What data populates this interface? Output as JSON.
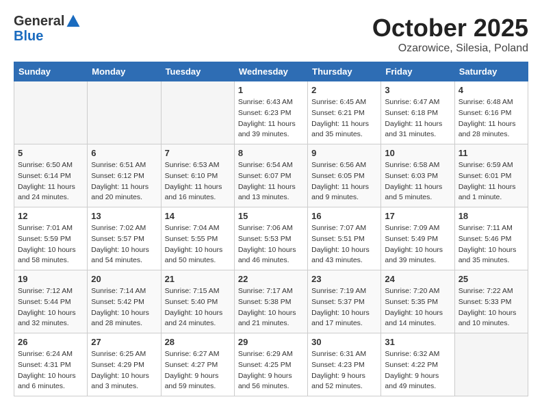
{
  "header": {
    "logo_general": "General",
    "logo_blue": "Blue",
    "month_title": "October 2025",
    "location": "Ozarowice, Silesia, Poland"
  },
  "days_of_week": [
    "Sunday",
    "Monday",
    "Tuesday",
    "Wednesday",
    "Thursday",
    "Friday",
    "Saturday"
  ],
  "weeks": [
    [
      {
        "day": "",
        "empty": true
      },
      {
        "day": "",
        "empty": true
      },
      {
        "day": "",
        "empty": true
      },
      {
        "day": "1",
        "sunrise": "Sunrise: 6:43 AM",
        "sunset": "Sunset: 6:23 PM",
        "daylight": "Daylight: 11 hours and 39 minutes."
      },
      {
        "day": "2",
        "sunrise": "Sunrise: 6:45 AM",
        "sunset": "Sunset: 6:21 PM",
        "daylight": "Daylight: 11 hours and 35 minutes."
      },
      {
        "day": "3",
        "sunrise": "Sunrise: 6:47 AM",
        "sunset": "Sunset: 6:18 PM",
        "daylight": "Daylight: 11 hours and 31 minutes."
      },
      {
        "day": "4",
        "sunrise": "Sunrise: 6:48 AM",
        "sunset": "Sunset: 6:16 PM",
        "daylight": "Daylight: 11 hours and 28 minutes."
      }
    ],
    [
      {
        "day": "5",
        "sunrise": "Sunrise: 6:50 AM",
        "sunset": "Sunset: 6:14 PM",
        "daylight": "Daylight: 11 hours and 24 minutes."
      },
      {
        "day": "6",
        "sunrise": "Sunrise: 6:51 AM",
        "sunset": "Sunset: 6:12 PM",
        "daylight": "Daylight: 11 hours and 20 minutes."
      },
      {
        "day": "7",
        "sunrise": "Sunrise: 6:53 AM",
        "sunset": "Sunset: 6:10 PM",
        "daylight": "Daylight: 11 hours and 16 minutes."
      },
      {
        "day": "8",
        "sunrise": "Sunrise: 6:54 AM",
        "sunset": "Sunset: 6:07 PM",
        "daylight": "Daylight: 11 hours and 13 minutes."
      },
      {
        "day": "9",
        "sunrise": "Sunrise: 6:56 AM",
        "sunset": "Sunset: 6:05 PM",
        "daylight": "Daylight: 11 hours and 9 minutes."
      },
      {
        "day": "10",
        "sunrise": "Sunrise: 6:58 AM",
        "sunset": "Sunset: 6:03 PM",
        "daylight": "Daylight: 11 hours and 5 minutes."
      },
      {
        "day": "11",
        "sunrise": "Sunrise: 6:59 AM",
        "sunset": "Sunset: 6:01 PM",
        "daylight": "Daylight: 11 hours and 1 minute."
      }
    ],
    [
      {
        "day": "12",
        "sunrise": "Sunrise: 7:01 AM",
        "sunset": "Sunset: 5:59 PM",
        "daylight": "Daylight: 10 hours and 58 minutes."
      },
      {
        "day": "13",
        "sunrise": "Sunrise: 7:02 AM",
        "sunset": "Sunset: 5:57 PM",
        "daylight": "Daylight: 10 hours and 54 minutes."
      },
      {
        "day": "14",
        "sunrise": "Sunrise: 7:04 AM",
        "sunset": "Sunset: 5:55 PM",
        "daylight": "Daylight: 10 hours and 50 minutes."
      },
      {
        "day": "15",
        "sunrise": "Sunrise: 7:06 AM",
        "sunset": "Sunset: 5:53 PM",
        "daylight": "Daylight: 10 hours and 46 minutes."
      },
      {
        "day": "16",
        "sunrise": "Sunrise: 7:07 AM",
        "sunset": "Sunset: 5:51 PM",
        "daylight": "Daylight: 10 hours and 43 minutes."
      },
      {
        "day": "17",
        "sunrise": "Sunrise: 7:09 AM",
        "sunset": "Sunset: 5:49 PM",
        "daylight": "Daylight: 10 hours and 39 minutes."
      },
      {
        "day": "18",
        "sunrise": "Sunrise: 7:11 AM",
        "sunset": "Sunset: 5:46 PM",
        "daylight": "Daylight: 10 hours and 35 minutes."
      }
    ],
    [
      {
        "day": "19",
        "sunrise": "Sunrise: 7:12 AM",
        "sunset": "Sunset: 5:44 PM",
        "daylight": "Daylight: 10 hours and 32 minutes."
      },
      {
        "day": "20",
        "sunrise": "Sunrise: 7:14 AM",
        "sunset": "Sunset: 5:42 PM",
        "daylight": "Daylight: 10 hours and 28 minutes."
      },
      {
        "day": "21",
        "sunrise": "Sunrise: 7:15 AM",
        "sunset": "Sunset: 5:40 PM",
        "daylight": "Daylight: 10 hours and 24 minutes."
      },
      {
        "day": "22",
        "sunrise": "Sunrise: 7:17 AM",
        "sunset": "Sunset: 5:38 PM",
        "daylight": "Daylight: 10 hours and 21 minutes."
      },
      {
        "day": "23",
        "sunrise": "Sunrise: 7:19 AM",
        "sunset": "Sunset: 5:37 PM",
        "daylight": "Daylight: 10 hours and 17 minutes."
      },
      {
        "day": "24",
        "sunrise": "Sunrise: 7:20 AM",
        "sunset": "Sunset: 5:35 PM",
        "daylight": "Daylight: 10 hours and 14 minutes."
      },
      {
        "day": "25",
        "sunrise": "Sunrise: 7:22 AM",
        "sunset": "Sunset: 5:33 PM",
        "daylight": "Daylight: 10 hours and 10 minutes."
      }
    ],
    [
      {
        "day": "26",
        "sunrise": "Sunrise: 6:24 AM",
        "sunset": "Sunset: 4:31 PM",
        "daylight": "Daylight: 10 hours and 6 minutes."
      },
      {
        "day": "27",
        "sunrise": "Sunrise: 6:25 AM",
        "sunset": "Sunset: 4:29 PM",
        "daylight": "Daylight: 10 hours and 3 minutes."
      },
      {
        "day": "28",
        "sunrise": "Sunrise: 6:27 AM",
        "sunset": "Sunset: 4:27 PM",
        "daylight": "Daylight: 9 hours and 59 minutes."
      },
      {
        "day": "29",
        "sunrise": "Sunrise: 6:29 AM",
        "sunset": "Sunset: 4:25 PM",
        "daylight": "Daylight: 9 hours and 56 minutes."
      },
      {
        "day": "30",
        "sunrise": "Sunrise: 6:31 AM",
        "sunset": "Sunset: 4:23 PM",
        "daylight": "Daylight: 9 hours and 52 minutes."
      },
      {
        "day": "31",
        "sunrise": "Sunrise: 6:32 AM",
        "sunset": "Sunset: 4:22 PM",
        "daylight": "Daylight: 9 hours and 49 minutes."
      },
      {
        "day": "",
        "empty": true
      }
    ]
  ]
}
